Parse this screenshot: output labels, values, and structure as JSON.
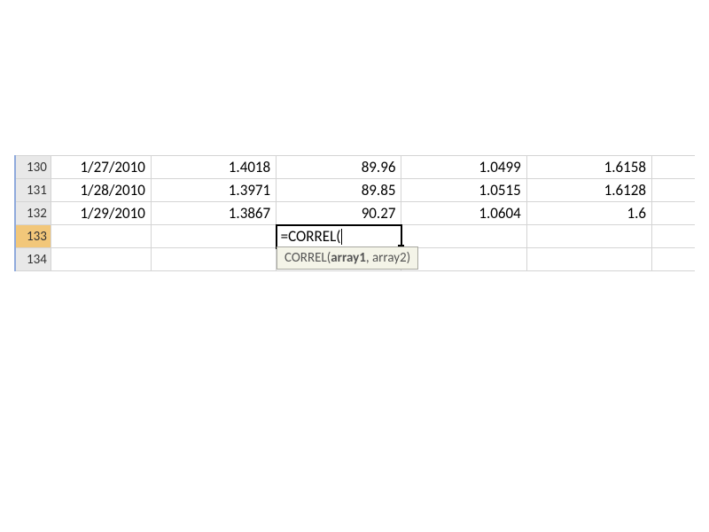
{
  "rows": [
    {
      "num": "130",
      "a": "1/27/2010",
      "b": "1.4018",
      "c": "89.96",
      "d": "1.0499",
      "e": "1.6158"
    },
    {
      "num": "131",
      "a": "1/28/2010",
      "b": "1.3971",
      "c": "89.85",
      "d": "1.0515",
      "e": "1.6128"
    },
    {
      "num": "132",
      "a": "1/29/2010",
      "b": "1.3867",
      "c": "90.27",
      "d": "1.0604",
      "e": "1.6"
    }
  ],
  "editing_row_num": "133",
  "empty_row_num": "134",
  "formula_text": "=CORREL(",
  "tooltip": {
    "fn": "CORREL(",
    "arg1": "array1",
    "sep": ", ",
    "arg2": "array2",
    "close": ")"
  }
}
